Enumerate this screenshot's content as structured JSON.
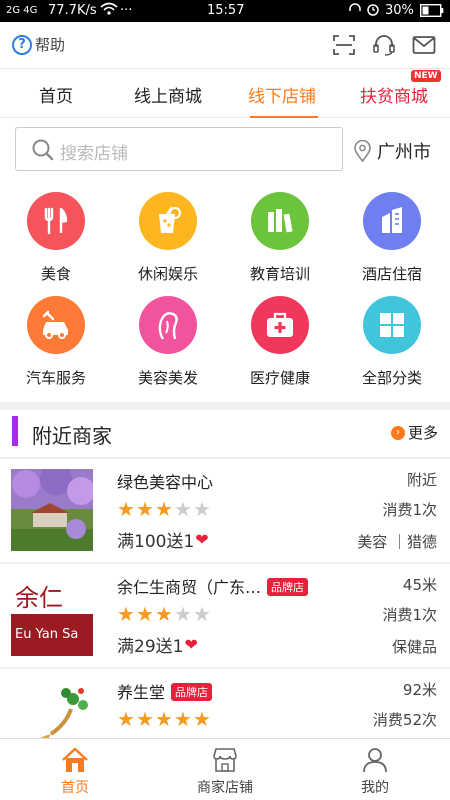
{
  "status": {
    "signal": "2G 4G",
    "speed": "77.7K/s",
    "time": "15:57",
    "battery": "30%"
  },
  "header": {
    "help_label": "帮助",
    "help_icon_glyph": "?"
  },
  "tabs": [
    {
      "label": "首页"
    },
    {
      "label": "线上商城"
    },
    {
      "label": "线下店铺"
    },
    {
      "label": "扶贫商城",
      "badge": "NEW"
    }
  ],
  "search": {
    "placeholder": "搜索店铺",
    "city": "广州市"
  },
  "categories": [
    {
      "label": "美食",
      "color": "#f4545a",
      "icon": "utensils-icon"
    },
    {
      "label": "休闲娱乐",
      "color": "#fdb61f",
      "icon": "drink-icon"
    },
    {
      "label": "教育培训",
      "color": "#6cc43d",
      "icon": "books-icon"
    },
    {
      "label": "酒店住宿",
      "color": "#6f7ff0",
      "icon": "building-icon"
    },
    {
      "label": "汽车服务",
      "color": "#fe7a36",
      "icon": "car-icon"
    },
    {
      "label": "美容美发",
      "color": "#f1549c",
      "icon": "hair-icon"
    },
    {
      "label": "医疗健康",
      "color": "#f1375c",
      "icon": "medical-kit-icon"
    },
    {
      "label": "全部分类",
      "color": "#41c5dc",
      "icon": "grid-icon"
    }
  ],
  "nearby": {
    "title": "附近商家",
    "more_label": "更多",
    "more_glyph": "›"
  },
  "merchants": [
    {
      "name": "绿色美容中心",
      "distance": "附近",
      "rating": 3,
      "consume": "消费1次",
      "promo": "满100送1",
      "tags": "美容 ｜猎德",
      "brand": ""
    },
    {
      "name": "余仁生商贸（广东…",
      "distance": "45米",
      "rating": 3,
      "consume": "消费1次",
      "promo": "满29送1",
      "tags": "保健品",
      "brand": "品牌店"
    },
    {
      "name": "养生堂",
      "distance": "92米",
      "rating": 5,
      "consume": "消费52次",
      "promo": "",
      "tags": "",
      "brand": "品牌店"
    }
  ],
  "merchant_thumb_texts": {
    "eu_yan_sang_cn": "余仁",
    "eu_yan_sang_en": "Eu Yan Sa"
  },
  "bottom_nav": [
    {
      "label": "首页",
      "active": true
    },
    {
      "label": "商家店铺"
    },
    {
      "label": "我的"
    }
  ],
  "colors": {
    "accent": "#ff7a1a",
    "heart": "#e8213a",
    "star_on": "#f59a23",
    "star_off": "#cccccc"
  }
}
